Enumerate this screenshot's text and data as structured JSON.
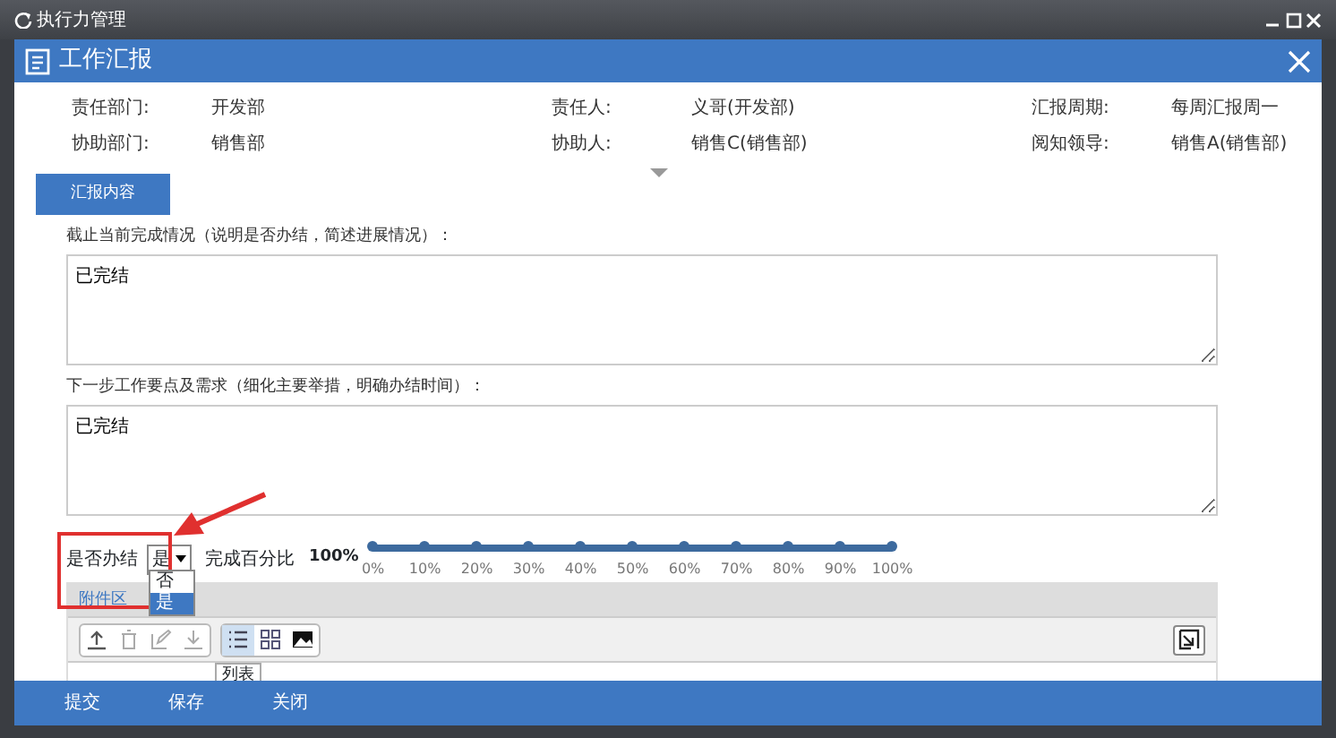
{
  "app_window": {
    "title": "执行力管理"
  },
  "dialog": {
    "title": "工作汇报"
  },
  "info_rows": [
    [
      {
        "label": "责任部门:",
        "value": "开发部"
      },
      {
        "label": "责任人:",
        "value": "义哥(开发部)"
      },
      {
        "label": "汇报周期:",
        "value": "每周汇报周一"
      }
    ],
    [
      {
        "label": "协助部门:",
        "value": "销售部"
      },
      {
        "label": "协助人:",
        "value": "销售C(销售部)"
      },
      {
        "label": "阅知领导:",
        "value": "销售A(销售部)"
      }
    ]
  ],
  "section_tab": "汇报内容",
  "fields": [
    {
      "label": "截止当前完成情况（说明是否办结，简述进展情况）：",
      "value": "已完结"
    },
    {
      "label": "下一步工作要点及需求（细化主要举措，明确办结时间）：",
      "value": "已完结"
    }
  ],
  "finished": {
    "label": "是否办结",
    "value": "是",
    "options": [
      {
        "label": "否",
        "selected": false
      },
      {
        "label": "是",
        "selected": true
      }
    ]
  },
  "percent": {
    "label": "完成百分比",
    "reading": "100%",
    "level": 1,
    "ticks": [
      "0%",
      "10%",
      "20%",
      "30%",
      "40%",
      "50%",
      "60%",
      "70%",
      "80%",
      "90%",
      "100%"
    ]
  },
  "attachments": {
    "title": "附件区",
    "tooltip": "列表",
    "view_buttons": [
      {
        "kind": "list",
        "selected": true
      },
      {
        "kind": "grid",
        "selected": false
      },
      {
        "kind": "image",
        "selected": false
      }
    ]
  },
  "footer_buttons": [
    "提交",
    "保存",
    "关闭"
  ]
}
